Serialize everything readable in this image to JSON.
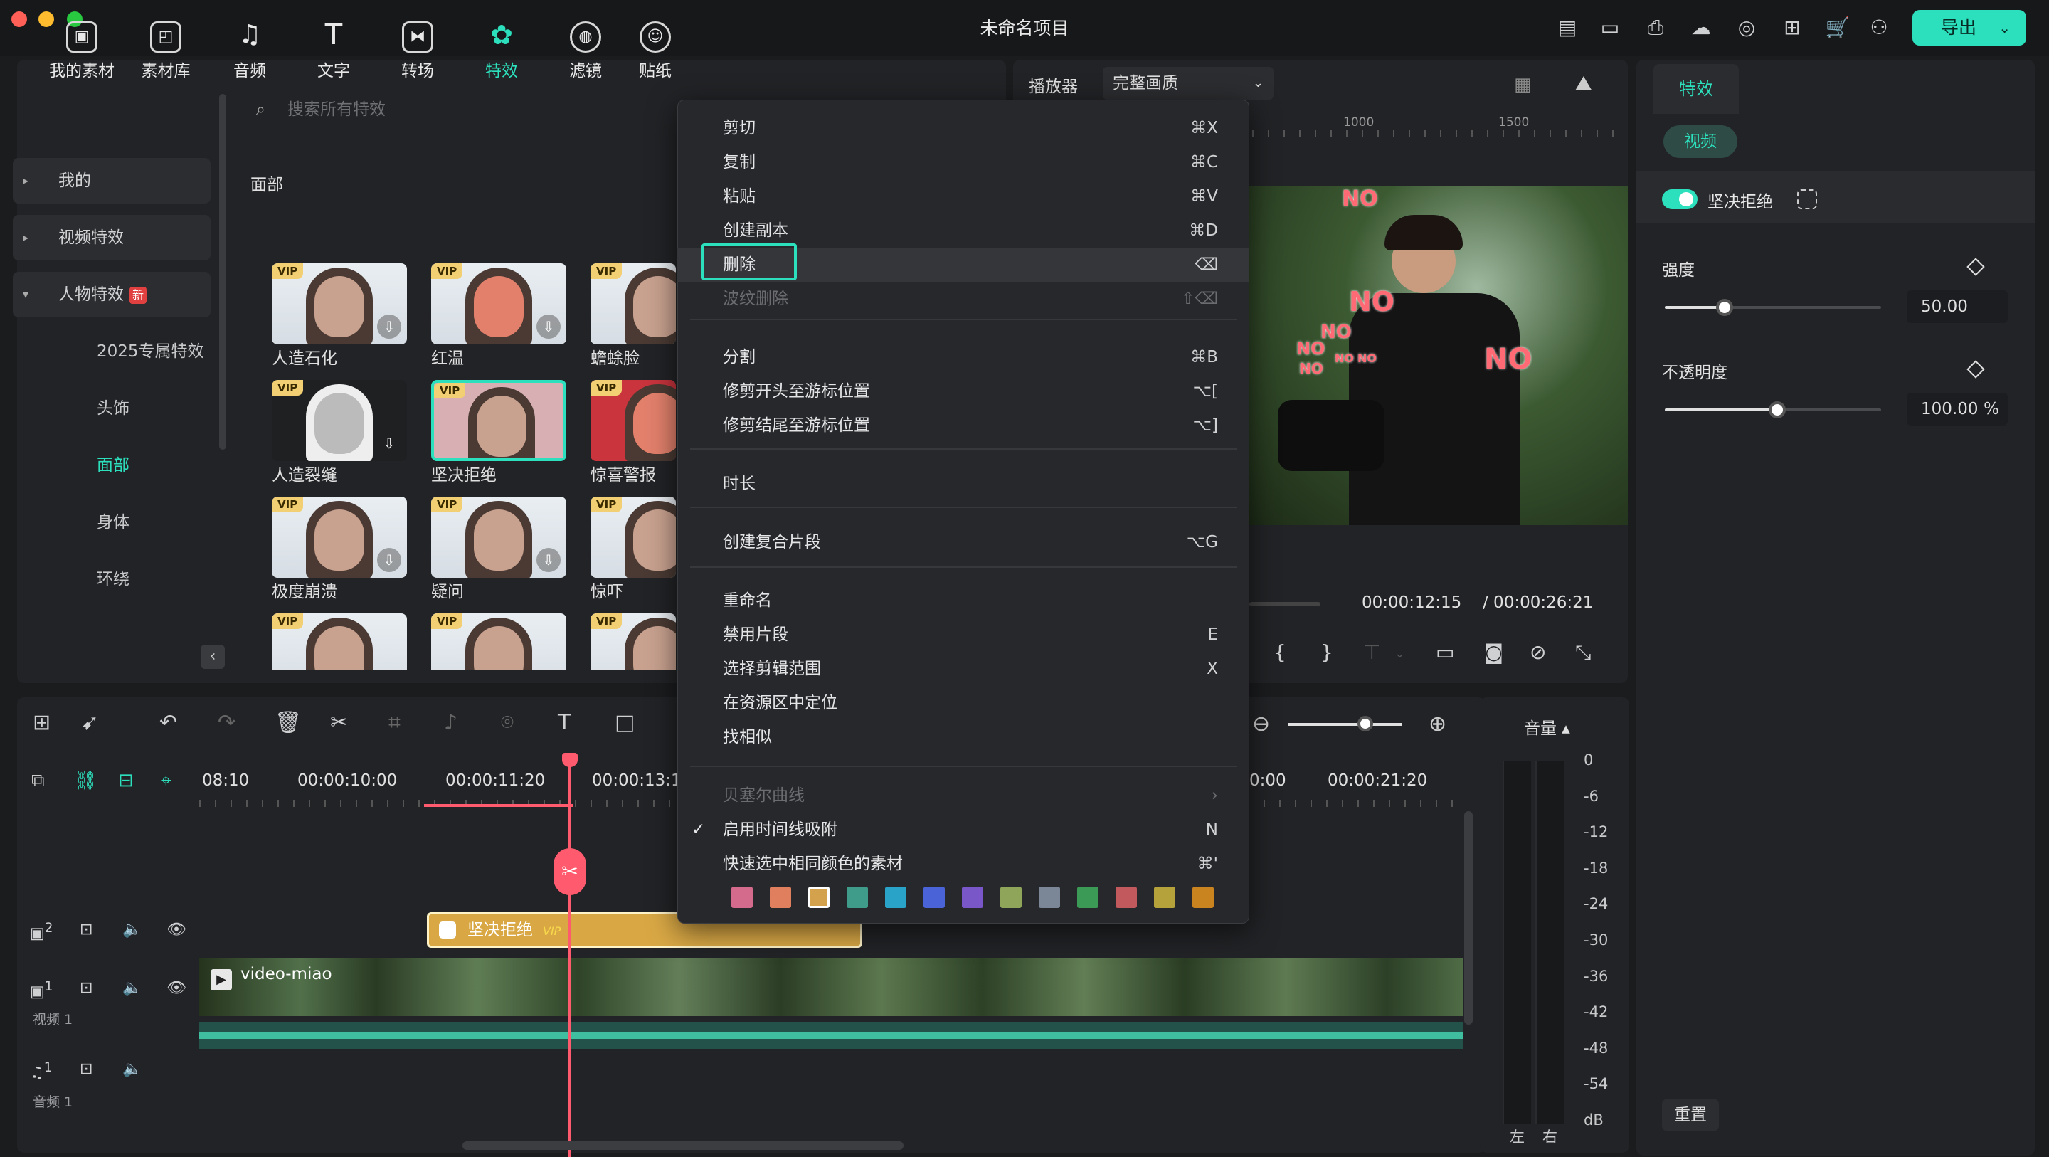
{
  "window": {
    "title": "未命名项目",
    "export_label": "导出"
  },
  "media_tabs": [
    {
      "label": "我的素材",
      "icon": "folder-icon"
    },
    {
      "label": "素材库",
      "icon": "library-icon"
    },
    {
      "label": "音频",
      "icon": "music-icon"
    },
    {
      "label": "文字",
      "icon": "text-icon"
    },
    {
      "label": "转场",
      "icon": "transition-icon"
    },
    {
      "label": "特效",
      "icon": "effects-icon"
    },
    {
      "label": "滤镜",
      "icon": "filter-icon"
    },
    {
      "label": "贴纸",
      "icon": "sticker-icon"
    }
  ],
  "sidebar": {
    "items": [
      "我的",
      "视频特效",
      "人物特效"
    ],
    "new_badge": "新",
    "subitems": [
      "2025专属特效",
      "头饰",
      "面部",
      "身体",
      "环绕"
    ]
  },
  "search": {
    "placeholder": "搜索所有特效"
  },
  "section_label": "面部",
  "thumbnails": [
    {
      "label": "人造石化",
      "vip": "VIP"
    },
    {
      "label": "红温",
      "vip": "VIP"
    },
    {
      "label": "蟾蜍脸",
      "vip": "VIP"
    },
    {
      "label": "人造裂缝",
      "vip": "VIP"
    },
    {
      "label": "坚决拒绝",
      "vip": "VIP"
    },
    {
      "label": "惊喜警报",
      "vip": "VIP"
    },
    {
      "label": "极度崩溃",
      "vip": "VIP"
    },
    {
      "label": "疑问",
      "vip": "VIP"
    },
    {
      "label": "惊吓",
      "vip": "VIP"
    },
    {
      "label": "",
      "vip": "VIP"
    },
    {
      "label": "",
      "vip": "VIP"
    },
    {
      "label": "",
      "vip": "VIP"
    }
  ],
  "player": {
    "label": "播放器",
    "quality": "完整画质",
    "ruler": [
      "1000",
      "1500"
    ],
    "overlay_text": [
      "NO",
      "NO",
      "NO",
      "NO",
      "NO",
      "NO",
      "NO",
      "NO"
    ],
    "time_current": "00:00:12:15",
    "time_total": "/ 00:00:26:21"
  },
  "props": {
    "tab": "特效",
    "chip": "视频",
    "effect_name": "坚决拒绝",
    "strength_label": "强度",
    "strength_value": "50.00",
    "strength_fraction": 0.5,
    "opacity_label": "不透明度",
    "opacity_value": "100.00",
    "opacity_unit": "%",
    "opacity_fraction": 1.0,
    "reset_label": "重置"
  },
  "context_menu": {
    "items": [
      {
        "label": "剪切",
        "shortcut": "⌘X"
      },
      {
        "label": "复制",
        "shortcut": "⌘C"
      },
      {
        "label": "粘贴",
        "shortcut": "⌘V"
      },
      {
        "label": "创建副本",
        "shortcut": "⌘D"
      },
      {
        "label": "删除",
        "shortcut": "⌫"
      },
      {
        "label": "波纹删除",
        "shortcut": "⇧⌫"
      },
      {
        "label": "分割",
        "shortcut": "⌘B"
      },
      {
        "label": "修剪开头至游标位置",
        "shortcut": "⌥["
      },
      {
        "label": "修剪结尾至游标位置",
        "shortcut": "⌥]"
      },
      {
        "label": "时长",
        "shortcut": ""
      },
      {
        "label": "创建复合片段",
        "shortcut": "⌥G"
      },
      {
        "label": "重命名",
        "shortcut": ""
      },
      {
        "label": "禁用片段",
        "shortcut": "E"
      },
      {
        "label": "选择剪辑范围",
        "shortcut": "X"
      },
      {
        "label": "在资源区中定位",
        "shortcut": ""
      },
      {
        "label": "找相似",
        "shortcut": ""
      },
      {
        "label": "贝塞尔曲线",
        "shortcut": "›"
      },
      {
        "label": "启用时间线吸附",
        "shortcut": "N"
      },
      {
        "label": "快速选中相同颜色的素材",
        "shortcut": "⌘'"
      }
    ],
    "check_mark": "✓",
    "swatches": [
      "#d56b8c",
      "#e07f5e",
      "#d4a24c",
      "#3f9c8a",
      "#2aa3c9",
      "#4a63d6",
      "#7a57c9",
      "#8fa55a",
      "#7b8797",
      "#3b9a55",
      "#c25a5d",
      "#b6a23a",
      "#c9841f"
    ]
  },
  "timeline": {
    "times": [
      "08:10",
      "00:00:10:00",
      "00:00:11:20",
      "00:00:13:1",
      "0:00",
      "00:00:21:20"
    ],
    "fx_clip": "坚决拒绝",
    "fx_clip_vip": "VIP",
    "video_clip": "video-miao",
    "track_video_num": "1",
    "track_fx_num": "2",
    "track_audio_num": "1",
    "track_video_label": "视频 1",
    "track_audio_label": "音频 1"
  },
  "meter": {
    "title": "音量 ▴",
    "ticks": [
      "0",
      "-6",
      "-12",
      "-18",
      "-24",
      "-30",
      "-36",
      "-42",
      "-48",
      "-54",
      "dB"
    ],
    "left": "左",
    "right": "右"
  }
}
